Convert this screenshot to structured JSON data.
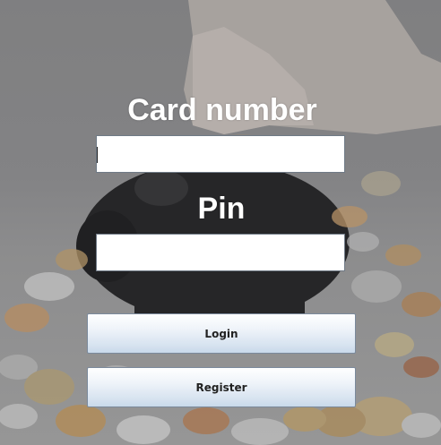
{
  "form": {
    "card_label": "Card number",
    "card_value": "",
    "pin_label": "Pin",
    "pin_value": "",
    "login_label": "Login",
    "register_label": "Register"
  },
  "colors": {
    "label_text": "#ffffff",
    "button_top": "#ffffff",
    "button_bottom": "#c9d9ea",
    "field_border": "#6f7a86"
  }
}
